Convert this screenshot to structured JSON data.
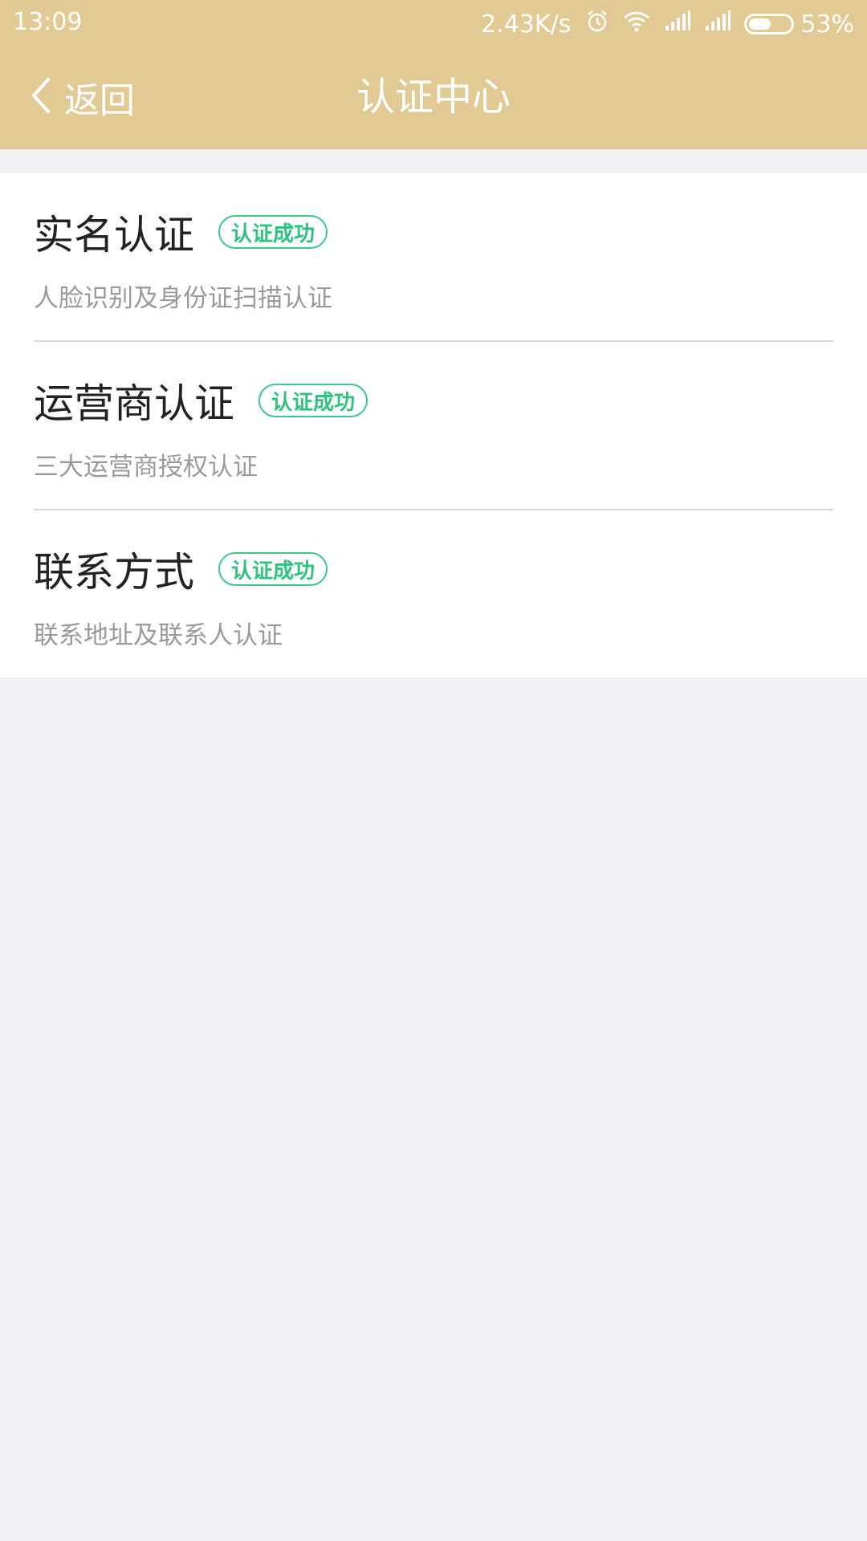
{
  "status_bar": {
    "time": "13:09",
    "network_speed": "2.43K/s",
    "icons": [
      "alarm-icon",
      "wifi-icon",
      "signal-icon",
      "signal-icon"
    ],
    "battery_percent": "53%",
    "battery_level": 0.53
  },
  "navbar": {
    "back_label": "返回",
    "title": "认证中心",
    "background_color": "#e1ca93"
  },
  "items": [
    {
      "title": "实名认证",
      "badge": "认证成功",
      "description": "人脸识别及身份证扫描认证"
    },
    {
      "title": "运营商认证",
      "badge": "认证成功",
      "description": "三大运营商授权认证"
    },
    {
      "title": "联系方式",
      "badge": "认证成功",
      "description": "联系地址及联系人认证"
    }
  ],
  "colors": {
    "badge_green": "#2ec27e",
    "page_background": "#f1f2f6"
  }
}
